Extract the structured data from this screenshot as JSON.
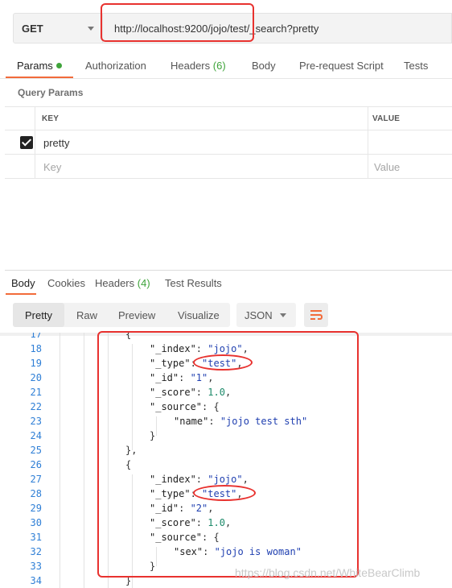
{
  "request": {
    "method": "GET",
    "url": "http://localhost:9200/jojo/test/_search?pretty"
  },
  "request_tabs": [
    {
      "label": "Params"
    },
    {
      "label": "Authorization"
    },
    {
      "label": "Headers",
      "count": "(6)"
    },
    {
      "label": "Body"
    },
    {
      "label": "Pre-request Script"
    },
    {
      "label": "Tests"
    }
  ],
  "query_params": {
    "title": "Query Params",
    "key_header": "KEY",
    "value_header": "VALUE",
    "rows": [
      {
        "checked": true,
        "key": "pretty",
        "value": ""
      }
    ],
    "key_placeholder": "Key",
    "value_placeholder": "Value"
  },
  "response_tabs": [
    {
      "label": "Body"
    },
    {
      "label": "Cookies"
    },
    {
      "label": "Headers",
      "count": "(4)"
    },
    {
      "label": "Test Results"
    }
  ],
  "view_modes": [
    "Pretty",
    "Raw",
    "Preview",
    "Visualize"
  ],
  "format": "JSON",
  "code_lines": [
    {
      "n": "17",
      "t": "{"
    },
    {
      "n": "18",
      "t": "\"_index\": \"jojo\","
    },
    {
      "n": "19",
      "t": "\"_type\": \"test\","
    },
    {
      "n": "20",
      "t": "\"_id\": \"1\","
    },
    {
      "n": "21",
      "t": "\"_score\": 1.0,"
    },
    {
      "n": "22",
      "t": "\"_source\": {"
    },
    {
      "n": "23",
      "t": "\"name\": \"jojo test sth\""
    },
    {
      "n": "24",
      "t": "}"
    },
    {
      "n": "25",
      "t": "},"
    },
    {
      "n": "26",
      "t": "{"
    },
    {
      "n": "27",
      "t": "\"_index\": \"jojo\","
    },
    {
      "n": "28",
      "t": "\"_type\": \"test\","
    },
    {
      "n": "29",
      "t": "\"_id\": \"2\","
    },
    {
      "n": "30",
      "t": "\"_score\": 1.0,"
    },
    {
      "n": "31",
      "t": "\"_source\": {"
    },
    {
      "n": "32",
      "t": "\"sex\": \"jojo is woman\""
    },
    {
      "n": "33",
      "t": "}"
    },
    {
      "n": "34",
      "t": "}"
    }
  ],
  "watermark": "https://blog.csdn.net/WhiteBearClimb",
  "colors": {
    "accent": "#f26b3a",
    "success": "#3fa43b",
    "annotation": "#e8322f"
  }
}
